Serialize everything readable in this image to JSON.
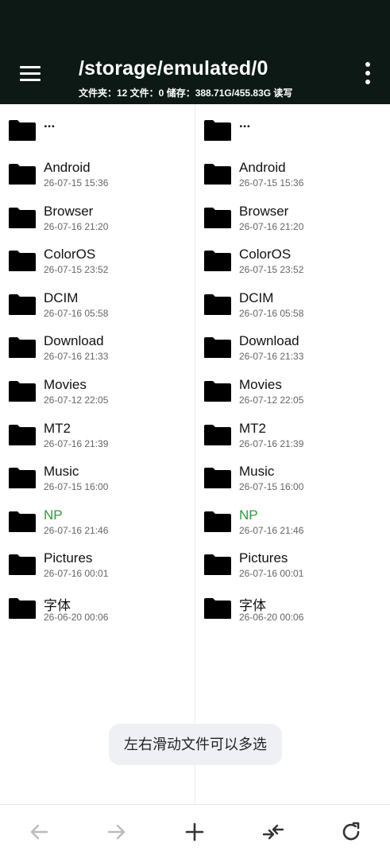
{
  "header": {
    "path": "/storage/emulated/0",
    "info": "文件夹：12  文件：0  储存：388.71G/455.83G  读写"
  },
  "up_label": "...",
  "folders": [
    {
      "name": "Android",
      "date": "26-07-15 15:36",
      "highlight": false
    },
    {
      "name": "Browser",
      "date": "26-07-16 21:20",
      "highlight": false
    },
    {
      "name": "ColorOS",
      "date": "26-07-15 23:52",
      "highlight": false
    },
    {
      "name": "DCIM",
      "date": "26-07-16 05:58",
      "highlight": false
    },
    {
      "name": "Download",
      "date": "26-07-16 21:33",
      "highlight": false
    },
    {
      "name": "Movies",
      "date": "26-07-12 22:05",
      "highlight": false
    },
    {
      "name": "MT2",
      "date": "26-07-16 21:39",
      "highlight": false
    },
    {
      "name": "Music",
      "date": "26-07-15 16:00",
      "highlight": false
    },
    {
      "name": "NP",
      "date": "26-07-16 21:46",
      "highlight": true
    },
    {
      "name": "Pictures",
      "date": "26-07-16 00:01",
      "highlight": false
    },
    {
      "name": "字体",
      "date": "26-06-20 00:06",
      "highlight": false
    }
  ],
  "toast": "左右滑动文件可以多选",
  "colors": {
    "header_bg": "#0c1915",
    "highlight": "#2e9b3a",
    "disabled_icon": "#bbbbbb",
    "active_icon": "#333333"
  },
  "icons": {
    "menu": "hamburger-menu-icon",
    "more": "more-vert-icon",
    "folder": "folder-icon",
    "back": "arrow-left-icon",
    "forward": "arrow-right-icon",
    "add": "plus-icon",
    "swap": "swap-panes-icon",
    "refresh": "refresh-icon"
  }
}
